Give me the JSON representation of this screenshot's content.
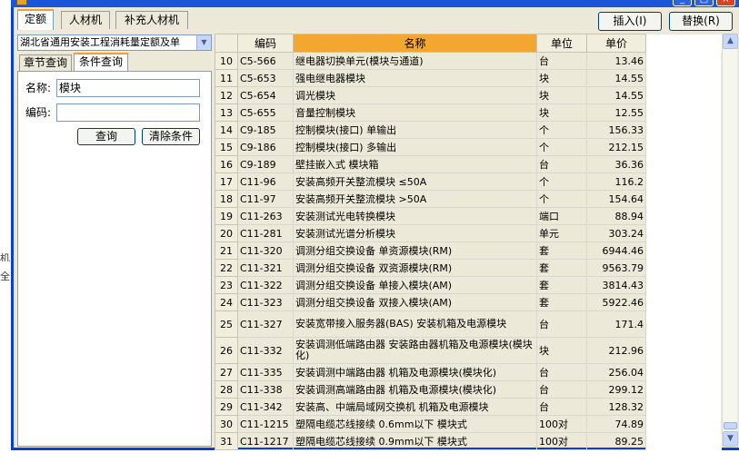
{
  "title_bar": {
    "icon": "app-icon",
    "minimize": "_",
    "maximize": "□",
    "close": "×"
  },
  "tabs": [
    {
      "label": "定额"
    },
    {
      "label": "人材机"
    },
    {
      "label": "补充人材机"
    }
  ],
  "toolbar": {
    "insert_label": "插入(I)",
    "replace_label": "替换(R)"
  },
  "left": {
    "library": "湖北省通用安装工程消耗量定额及单",
    "subtabs": [
      {
        "label": "章节查询"
      },
      {
        "label": "条件查询"
      }
    ],
    "name_label": "名称:",
    "name_value": "模块",
    "code_label": "编码:",
    "code_value": "",
    "query_button": "查询",
    "clear_button": "清除条件"
  },
  "table": {
    "columns": [
      "编码",
      "名称",
      "单位",
      "单价"
    ],
    "rows": [
      {
        "idx": "10",
        "code": "C5-566",
        "name": "继电器切换单元(模块与通道)",
        "unit": "台",
        "price": "13.46"
      },
      {
        "idx": "11",
        "code": "C5-653",
        "name": "强电继电器模块",
        "unit": "块",
        "price": "14.55"
      },
      {
        "idx": "12",
        "code": "C5-654",
        "name": "调光模块",
        "unit": "块",
        "price": "14.55"
      },
      {
        "idx": "13",
        "code": "C5-655",
        "name": "音量控制模块",
        "unit": "块",
        "price": "12.55"
      },
      {
        "idx": "14",
        "code": "C9-185",
        "name": "控制模块(接口) 单输出",
        "unit": "个",
        "price": "156.33"
      },
      {
        "idx": "15",
        "code": "C9-186",
        "name": "控制模块(接口) 多输出",
        "unit": "个",
        "price": "212.15"
      },
      {
        "idx": "16",
        "code": "C9-189",
        "name": "壁挂嵌入式 模块箱",
        "unit": "台",
        "price": "36.36"
      },
      {
        "idx": "17",
        "code": "C11-96",
        "name": "安装高频开关整流模块 ≤50A",
        "unit": "个",
        "price": "116.2"
      },
      {
        "idx": "18",
        "code": "C11-97",
        "name": "安装高频开关整流模块 >50A",
        "unit": "个",
        "price": "154.64"
      },
      {
        "idx": "19",
        "code": "C11-263",
        "name": "安装测试光电转换模块",
        "unit": "端口",
        "price": "88.94"
      },
      {
        "idx": "20",
        "code": "C11-281",
        "name": "安装测试光谱分析模块",
        "unit": "单元",
        "price": "303.24"
      },
      {
        "idx": "21",
        "code": "C11-320",
        "name": "调测分组交换设备 单资源模块(RM)",
        "unit": "套",
        "price": "6944.46"
      },
      {
        "idx": "22",
        "code": "C11-321",
        "name": "调测分组交换设备 双资源模块(RM)",
        "unit": "套",
        "price": "9563.79"
      },
      {
        "idx": "23",
        "code": "C11-322",
        "name": "调测分组交换设备 单接入模块(AM)",
        "unit": "套",
        "price": "3814.43"
      },
      {
        "idx": "24",
        "code": "C11-323",
        "name": "调测分组交换设备 双接入模块(AM)",
        "unit": "套",
        "price": "5922.46"
      },
      {
        "idx": "25",
        "code": "C11-327",
        "name": "安装宽带接入服务器(BAS) 安装机箱及电源模块",
        "unit": "台",
        "price": "171.4"
      },
      {
        "idx": "26",
        "code": "C11-332",
        "name": "安装调测低端路由器 安装路由器机箱及电源模块(模块化)",
        "unit": "块",
        "price": "212.96"
      },
      {
        "idx": "27",
        "code": "C11-335",
        "name": "安装调测中端路由器 机箱及电源模块(模块化)",
        "unit": "台",
        "price": "256.04"
      },
      {
        "idx": "28",
        "code": "C11-338",
        "name": "安装调测高端路由器 机箱及电源模块(模块化)",
        "unit": "台",
        "price": "299.12"
      },
      {
        "idx": "29",
        "code": "C11-342",
        "name": "安装高、中端局域网交换机 机箱及电源模块",
        "unit": "台",
        "price": "128.32"
      },
      {
        "idx": "30",
        "code": "C11-1215",
        "name": "塑隔电缆芯线接续 0.6mm以下 模块式",
        "unit": "100对",
        "price": "74.89"
      },
      {
        "idx": "31",
        "code": "C11-1217",
        "name": "塑隔电缆芯线接续 0.9mm以下 模块式",
        "unit": "100对",
        "price": "89.25"
      }
    ]
  },
  "scrollbar": {
    "up": "▲",
    "down": "▼"
  },
  "behind": {
    "a": "机显",
    "b": "全"
  },
  "colors": {
    "title_blue": "#1b56d9",
    "header_orange": "#f3a630",
    "tab_accent": "#f0a030"
  }
}
